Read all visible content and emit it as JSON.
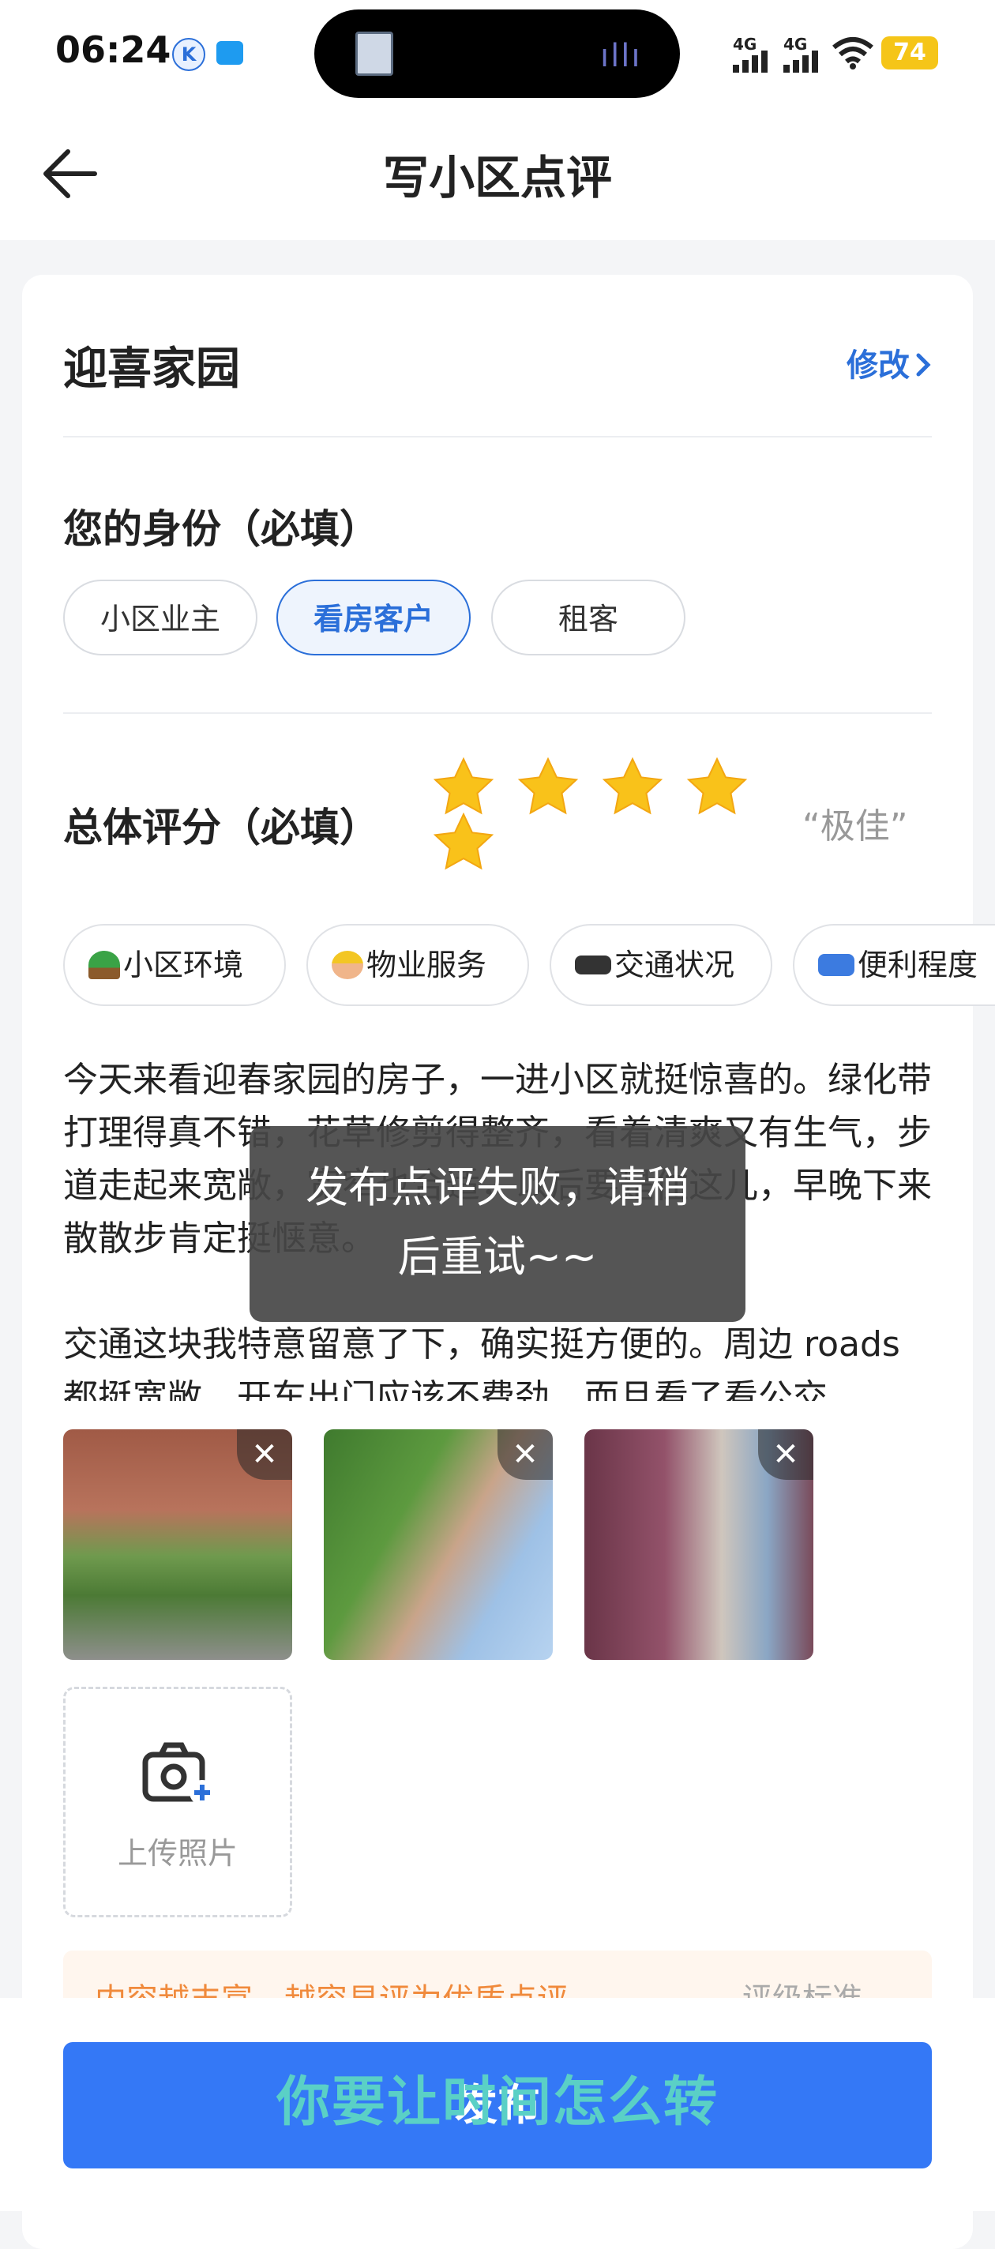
{
  "status": {
    "time": "06:24",
    "net1": "4G",
    "net2": "4G",
    "battery": "74"
  },
  "header": {
    "title": "写小区点评"
  },
  "community": {
    "name": "迎喜家园",
    "modify_label": "修改"
  },
  "identity": {
    "title": "您的身份（必填）",
    "options": [
      "小区业主",
      "看房客户",
      "租客"
    ],
    "selected": "看房客户"
  },
  "rating": {
    "title": "总体评分（必填）",
    "stars": 5,
    "max": 5,
    "word": "“极佳”"
  },
  "tags": [
    {
      "icon": "tree-icon",
      "label": "小区环境"
    },
    {
      "icon": "worker-icon",
      "label": "物业服务"
    },
    {
      "icon": "traffic-light-icon",
      "label": "交通状况"
    },
    {
      "icon": "car-icon",
      "label": "便利程度"
    }
  ],
  "review": {
    "p1": "今天来看迎春家园的房子，一进小区就挺惊喜的。绿化带打理得真不错，花草修剪得整齐，看着清爽又有生气，步道走起来宽敞，宽窄也合适，以后要是住这儿，早晚下来散散步肯定挺惬意。",
    "p2": "交通这块我特意留意了下，确实挺方便的。周边 roads 都挺宽敞，开车出门应该不费劲，而且看了看公交"
  },
  "toast": {
    "line1": "发布点评失败，请稍",
    "line2": "后重试~~"
  },
  "photos": {
    "close_label": "✕",
    "upload_label": "上传照片"
  },
  "tip": {
    "left": "内容越丰富，越容易评为优质点评",
    "right": "评级标准"
  },
  "publish": {
    "label": "发布"
  },
  "overlay": {
    "text": "你要让时间怎么转"
  }
}
